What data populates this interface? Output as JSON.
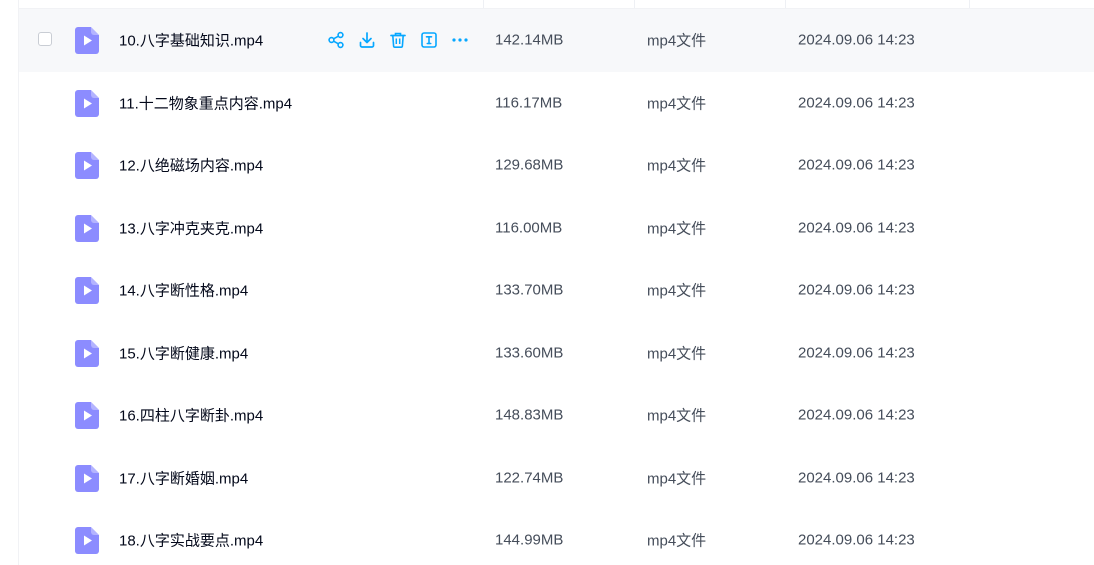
{
  "row_actions": [
    {
      "name": "share",
      "icon": "share-icon"
    },
    {
      "name": "download",
      "icon": "download-icon"
    },
    {
      "name": "delete",
      "icon": "trash-icon"
    },
    {
      "name": "rename",
      "icon": "rename-icon"
    },
    {
      "name": "more",
      "icon": "more-icon"
    }
  ],
  "colors": {
    "accent": "#06a7ff",
    "file_icon": "#8c8cff",
    "text_primary": "#03081a",
    "text_secondary": "#454d5a",
    "hover_bg": "#f7f8fa"
  },
  "files": [
    {
      "name": "10.八字基础知识.mp4",
      "size": "142.14MB",
      "type": "mp4文件",
      "modified": "2024.09.06 14:23",
      "hovered": true
    },
    {
      "name": "11.十二物象重点内容.mp4",
      "size": "116.17MB",
      "type": "mp4文件",
      "modified": "2024.09.06 14:23",
      "hovered": false
    },
    {
      "name": "12.八绝磁场内容.mp4",
      "size": "129.68MB",
      "type": "mp4文件",
      "modified": "2024.09.06 14:23",
      "hovered": false
    },
    {
      "name": "13.八字冲克夹克.mp4",
      "size": "116.00MB",
      "type": "mp4文件",
      "modified": "2024.09.06 14:23",
      "hovered": false
    },
    {
      "name": "14.八字断性格.mp4",
      "size": "133.70MB",
      "type": "mp4文件",
      "modified": "2024.09.06 14:23",
      "hovered": false
    },
    {
      "name": "15.八字断健康.mp4",
      "size": "133.60MB",
      "type": "mp4文件",
      "modified": "2024.09.06 14:23",
      "hovered": false
    },
    {
      "name": "16.四柱八字断卦.mp4",
      "size": "148.83MB",
      "type": "mp4文件",
      "modified": "2024.09.06 14:23",
      "hovered": false
    },
    {
      "name": "17.八字断婚姻.mp4",
      "size": "122.74MB",
      "type": "mp4文件",
      "modified": "2024.09.06 14:23",
      "hovered": false
    },
    {
      "name": "18.八字实战要点.mp4",
      "size": "144.99MB",
      "type": "mp4文件",
      "modified": "2024.09.06 14:23",
      "hovered": false
    }
  ]
}
